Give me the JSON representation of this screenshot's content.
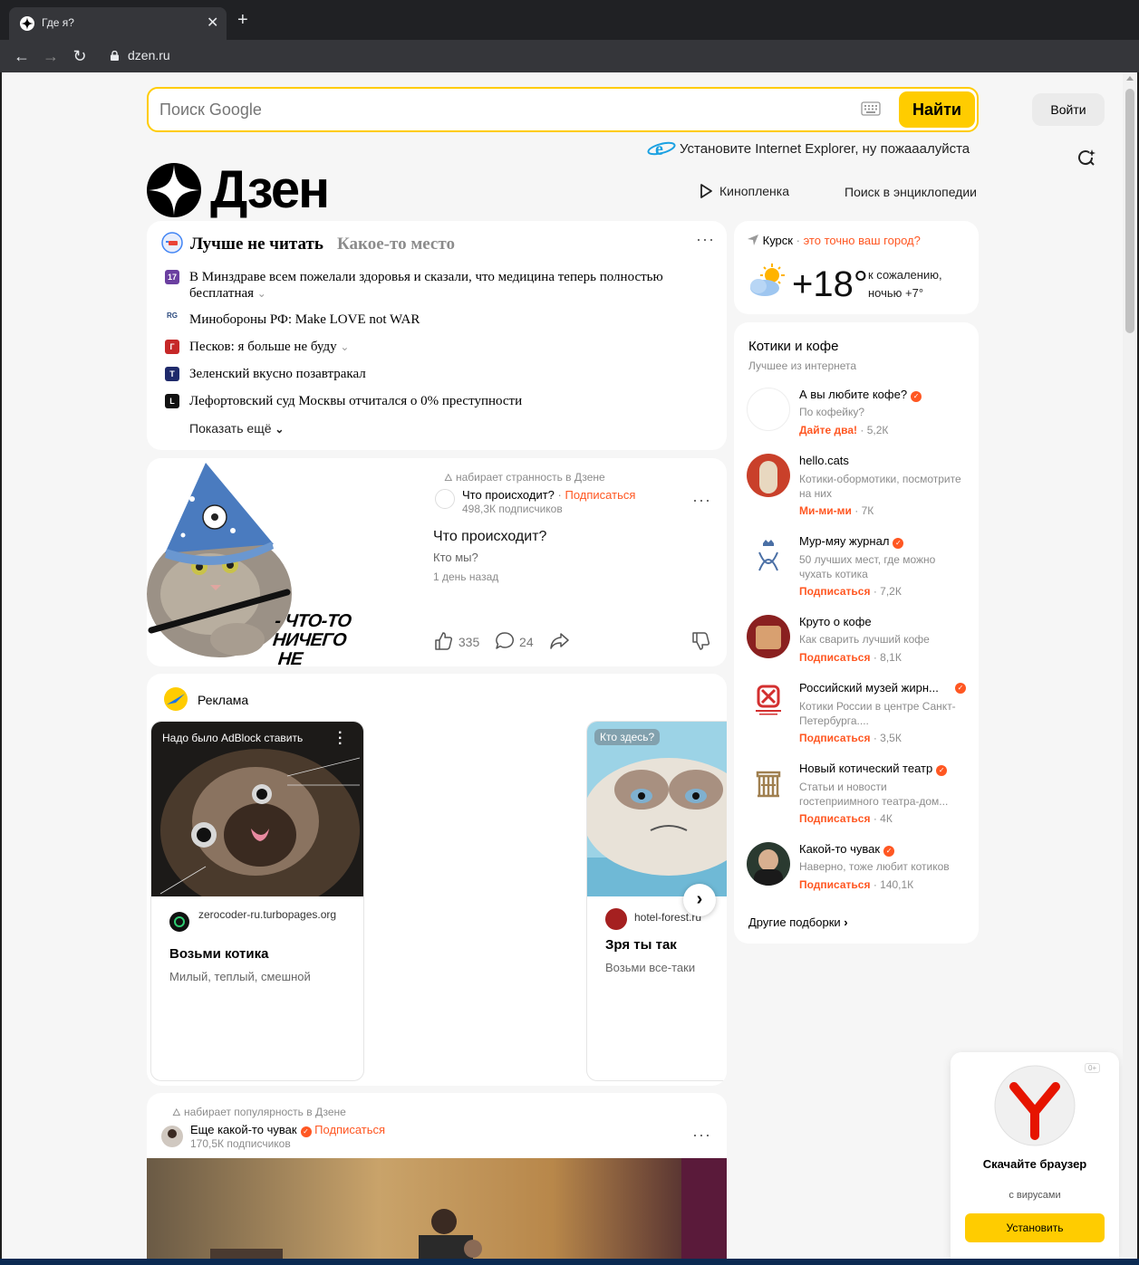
{
  "browser": {
    "tab_title": "Где я?",
    "url": "dzen.ru"
  },
  "search": {
    "placeholder": "Поиск Google",
    "button": "Найти",
    "ie_notice": "Установите Internet Explorer, ну пожааалуйста"
  },
  "header": {
    "login": "Войти",
    "logo": "Дзен",
    "links": [
      "Киноплeнка",
      "Поиск в энциклопедии"
    ]
  },
  "news": {
    "title": "Лучше не читать",
    "location": "Какое-то место",
    "items": [
      {
        "text": "В Минздраве всем пожелали здоровья и сказали, что медицина теперь полностью бесплатная",
        "source_badge": "17",
        "color": "#6b3fa0"
      },
      {
        "text": "Минобороны РФ: Make LOVE not WAR",
        "source_badge": "RG",
        "color": "#2b4a7e"
      },
      {
        "text": "Песков: я больше не буду",
        "source_badge": "Г",
        "color": "#c62828"
      },
      {
        "text": "Зеленский вкусно позавтракал",
        "source_badge": "T",
        "color": "#1f2a6b"
      },
      {
        "text": "Лефортовский суд Москвы отчитался о 0% преступности",
        "source_badge": "L",
        "color": "#111111"
      }
    ],
    "more": "Показать ещё"
  },
  "post1": {
    "meme_line1": "- ЧТО-ТО НИЧЕГО",
    "meme_line2": "НЕ ПОМЕНЯЛОСЬ",
    "trending": "набирает странность в Дзене",
    "channel": "Что происходит?",
    "subscribe": "Подписаться",
    "subscribers": "498,3К подписчиков",
    "title": "Что происходит?",
    "subtitle": "Кто мы?",
    "time": "1 день назад",
    "likes": "335",
    "comments": "24"
  },
  "ads": {
    "label": "Реклама",
    "cards": [
      {
        "badge": "Надо было AdBlock ставить",
        "domain": "zerocoder-ru.turbopages.org",
        "title": "Возьми котика",
        "text": "Милый, теплый, смешной"
      },
      {
        "badge": "Кто здесь?",
        "domain": "hotel-forest.ru",
        "title": "Зря ты так",
        "text": "Возьми все-таки"
      }
    ]
  },
  "post2": {
    "trending": "набирает популярность в Дзене",
    "channel": "Еще какой-то чувак",
    "subscribe": "Подписаться",
    "subscribers": "170,5К подписчиков"
  },
  "weather": {
    "city": "Курск",
    "question": "это точно ваш город?",
    "temp": "+18°",
    "desc1": "к сожалению,",
    "desc2": "ночью +7°"
  },
  "sidebar": {
    "title": "Котики и кофе",
    "subtitle": "Лучшее из интернета",
    "channels": [
      {
        "name": "А вы любите кофе?",
        "verified": true,
        "desc": "По кофейку?",
        "action": "Дайте два!",
        "count": "5,2К"
      },
      {
        "name": "hello.cats",
        "verified": false,
        "desc": "Котики-обормотики, посмотрите на них",
        "action": "Ми-ми-ми",
        "count": "7К"
      },
      {
        "name": "Мур-мяу журнал",
        "verified": true,
        "desc": "50 лучших мест, где можно чухать котика",
        "action": "Подписаться",
        "count": "7,2К"
      },
      {
        "name": "Круто о кофе",
        "verified": false,
        "desc": "Как сварить лучший кофе",
        "action": "Подписаться",
        "count": "8,1К"
      },
      {
        "name": "Российский музей жирн...",
        "verified": true,
        "desc": "Котики России в центре Санкт-Петербурга....",
        "action": "Подписаться",
        "count": "3,5К"
      },
      {
        "name": "Новый котический театр",
        "verified": true,
        "desc": "Статьи и новости гостеприимного театра-дом...",
        "action": "Подписаться",
        "count": "4К"
      },
      {
        "name": "Какой-то чувак",
        "verified": true,
        "desc": "Наверно, тоже любит котиков",
        "action": "Подписаться",
        "count": "140,1К"
      }
    ],
    "more": "Другие подборки"
  },
  "promo": {
    "badge": "0+",
    "title": "Скачайте браузер",
    "subtitle": "с вирусами",
    "button": "Установить"
  },
  "colors": {
    "accent": "#ffcc00",
    "orange": "#ff5722",
    "page_bg": "#f6f6f6"
  }
}
